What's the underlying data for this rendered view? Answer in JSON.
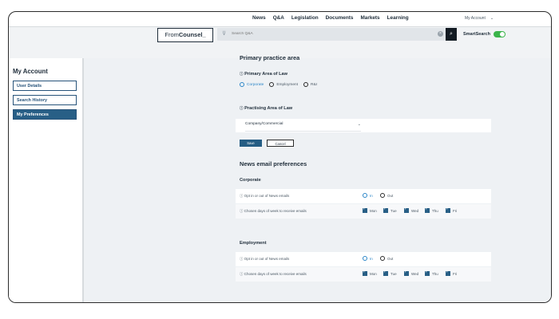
{
  "topnav": {
    "links": [
      "News",
      "Q&A",
      "Legislation",
      "Documents",
      "Markets",
      "Learning"
    ],
    "account_label": "My Account",
    "account_chevron_icon": "chevron-down-icon"
  },
  "header": {
    "logo_prefix": "From",
    "logo_strong": "Counsel_",
    "search_placeholder": "Search Q&A",
    "smart_search_label": "SmartSearch",
    "smart_search_enabled": true
  },
  "sidebar": {
    "title": "My Account",
    "items": [
      {
        "label": "User Details",
        "active": false
      },
      {
        "label": "Search History",
        "active": false
      },
      {
        "label": "My Preferences",
        "active": true
      }
    ]
  },
  "practice": {
    "title": "Primary practice area",
    "primary_label": "Primary Area of Law",
    "primary_options": [
      {
        "label": "Corporate",
        "selected": true
      },
      {
        "label": "Employment",
        "selected": false
      },
      {
        "label": "R&I",
        "selected": false
      }
    ],
    "practising_label": "Practising Area of Law",
    "practising_value": "Company/Commercial",
    "save_label": "Save",
    "cancel_label": "Cancel"
  },
  "news": {
    "title": "News email preferences",
    "sections": [
      {
        "name": "Corporate",
        "optin_label": "Opt in or out of News emails",
        "in_label": "In",
        "out_label": "Out",
        "in_selected": true,
        "days_label": "Chosen days of week to receive emails",
        "days": [
          "Mon",
          "Tue",
          "Wed",
          "Thu",
          "Fri"
        ]
      },
      {
        "name": "Employment",
        "optin_label": "Opt in or out of News emails",
        "in_label": "In",
        "out_label": "Out",
        "in_selected": true,
        "days_label": "Chosen days of week to receive emails",
        "days": [
          "Mon",
          "Tue",
          "Wed",
          "Thu",
          "Fri"
        ]
      }
    ]
  },
  "colors": {
    "accent": "#285f86",
    "toggle_on": "#3bb44a",
    "radio_selected": "#2c86c8"
  }
}
